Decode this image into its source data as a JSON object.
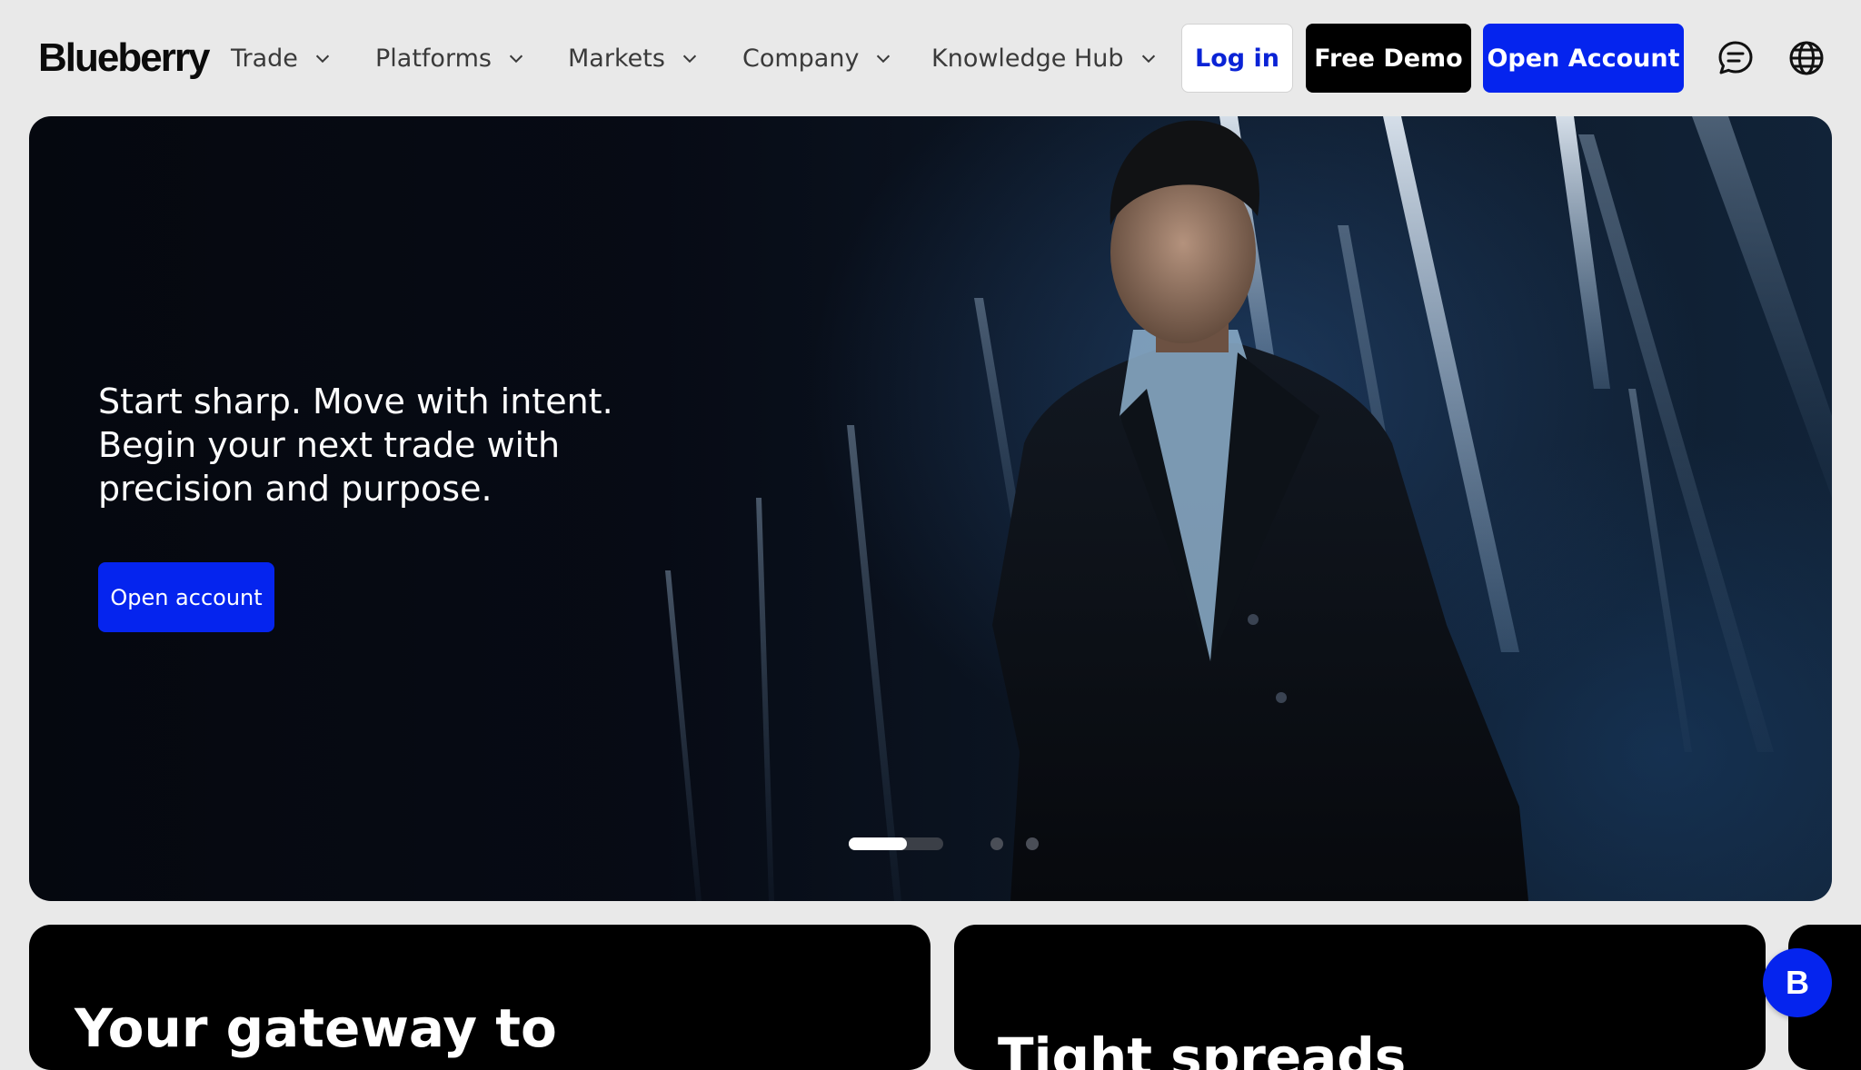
{
  "header": {
    "logo": "Blueberry",
    "nav": [
      {
        "label": "Trade"
      },
      {
        "label": "Platforms"
      },
      {
        "label": "Markets"
      },
      {
        "label": "Company"
      },
      {
        "label": "Knowledge Hub"
      }
    ],
    "login_label": "Log in",
    "demo_label": "Free Demo",
    "open_account_label": "Open Account",
    "icons": [
      "chat-icon",
      "globe-icon"
    ]
  },
  "hero": {
    "lines": [
      "Start sharp. Move with intent.",
      "Begin your next trade with",
      "precision and purpose."
    ],
    "cta_label": "Open account",
    "slides_total": 3,
    "slide_active": 1
  },
  "cards": {
    "card1_title": "Your gateway to",
    "card2_title": "Tight spreads"
  },
  "chat_widget": {
    "label": "B"
  },
  "colors": {
    "accent": "#0524ee",
    "login_text": "#0a23d6",
    "dark": "#000000",
    "page_bg": "#e9e9e9"
  }
}
